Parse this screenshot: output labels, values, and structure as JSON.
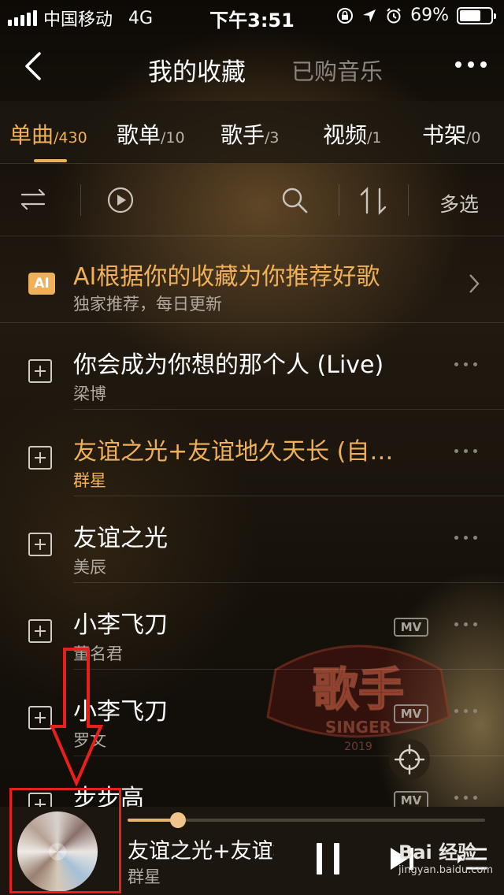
{
  "status_bar": {
    "carrier": "中国移动",
    "network": "4G",
    "time": "下午3:51",
    "battery": "69%",
    "battery_level": 0.69
  },
  "nav": {
    "title": "我的收藏",
    "subtitle": "已购音乐"
  },
  "tabs": [
    {
      "label": "单曲",
      "count": "/430",
      "active": true
    },
    {
      "label": "歌单",
      "count": "/10"
    },
    {
      "label": "歌手",
      "count": "/3"
    },
    {
      "label": "视频",
      "count": "/1"
    },
    {
      "label": "书架",
      "count": "/0"
    }
  ],
  "toolbar": {
    "multi_select": "多选"
  },
  "ai": {
    "badge": "AI",
    "title": "AI根据你的收藏为你推荐好歌",
    "subtitle": "独家推荐，每日更新"
  },
  "songs": [
    {
      "title": "你会成为你想的那个人 (Live)",
      "artist": "梁博"
    },
    {
      "title": "友谊之光+友谊地久天长 (自…",
      "artist": "群星",
      "playing": true
    },
    {
      "title": "友谊之光",
      "artist": "美辰"
    },
    {
      "title": "小李飞刀",
      "artist": "董名君",
      "mv": "MV"
    },
    {
      "title": "小李飞刀",
      "artist": "罗文",
      "mv": "MV"
    },
    {
      "title": "步步高",
      "artist": "",
      "mv": "MV"
    }
  ],
  "player": {
    "title": "友谊之光+友谊地",
    "artist": "群星",
    "progress": 0.14
  },
  "background": {
    "logo_text": "歌手",
    "logo_sub": "SINGER",
    "logo_year": "2019"
  },
  "watermark": {
    "title": "Bai 经验",
    "url": "jingyan.baidu.com"
  },
  "colors": {
    "accent": "#f0b05a",
    "annotation": "#e8201c"
  }
}
